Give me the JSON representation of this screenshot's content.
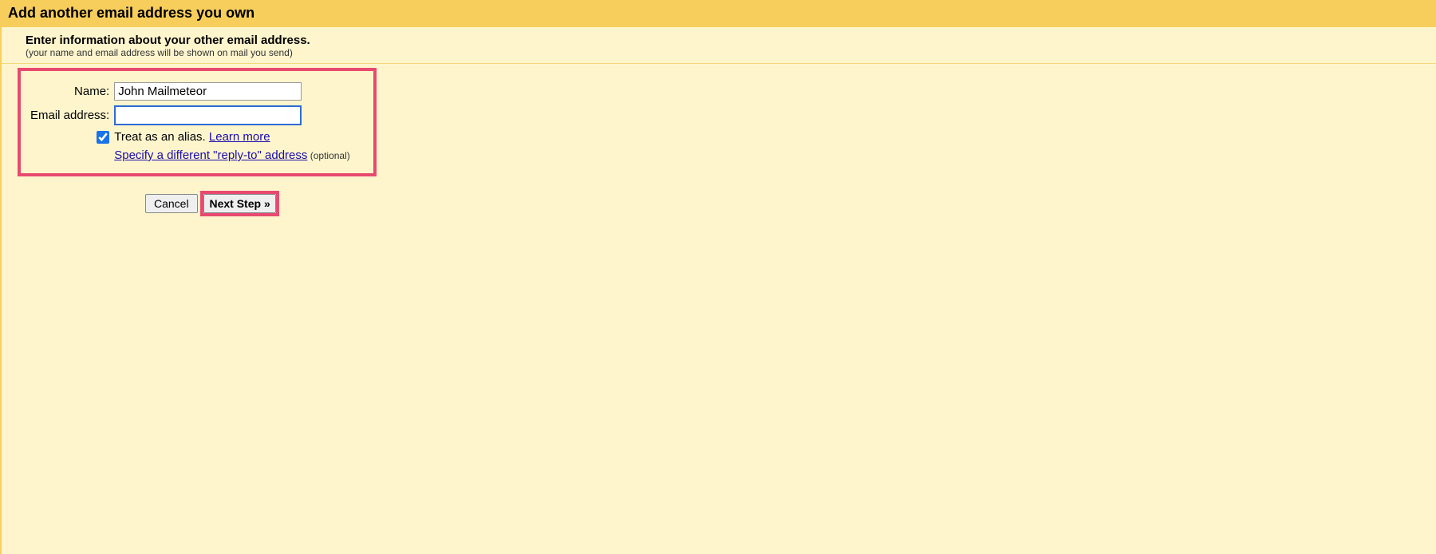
{
  "header": {
    "title": "Add another email address you own"
  },
  "subheader": {
    "title": "Enter information about your other email address.",
    "note": "(your name and email address will be shown on mail you send)"
  },
  "form": {
    "name_label": "Name:",
    "name_value": "John Mailmeteor",
    "email_label": "Email address:",
    "email_value": "",
    "alias_text": "Treat as an alias. ",
    "learn_more": "Learn more",
    "reply_to_link": "Specify a different \"reply-to\" address",
    "optional_label": " (optional)"
  },
  "buttons": {
    "cancel": "Cancel",
    "next": "Next Step »"
  }
}
